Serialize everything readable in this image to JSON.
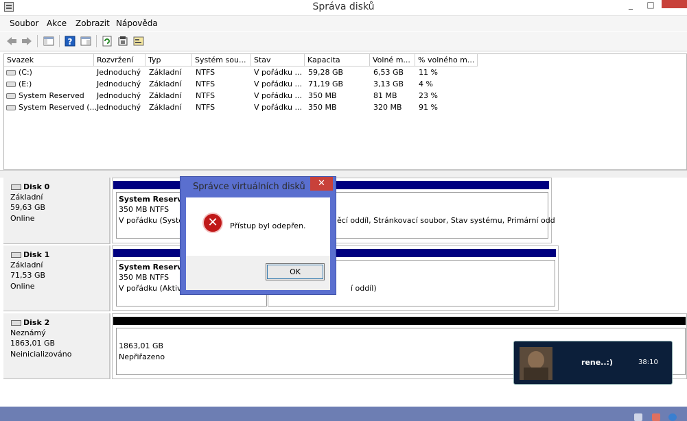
{
  "window": {
    "title": "Správa disků",
    "minimize": "_",
    "maximize": "□"
  },
  "menu": [
    "Soubor",
    "Akce",
    "Zobrazit",
    "Nápověda"
  ],
  "toolbar": [
    "back-icon",
    "forward-icon",
    "console-tree-icon",
    "help-icon",
    "properties-icon",
    "refresh-icon",
    "settings-icon",
    "export-icon"
  ],
  "volume_table": {
    "columns": [
      "Svazek",
      "Rozvržení",
      "Typ",
      "Systém sou...",
      "Stav",
      "Kapacita",
      "Volné m...",
      "% volného m..."
    ],
    "rows": [
      [
        "(C:)",
        "Jednoduchý",
        "Základní",
        "NTFS",
        "V pořádku ...",
        "59,28 GB",
        "6,53 GB",
        "11 %"
      ],
      [
        "(E:)",
        "Jednoduchý",
        "Základní",
        "NTFS",
        "V pořádku ...",
        "71,19 GB",
        "3,13 GB",
        "4 %"
      ],
      [
        "System Reserved",
        "Jednoduchý",
        "Základní",
        "NTFS",
        "V pořádku ...",
        "350 MB",
        "81 MB",
        "23 %"
      ],
      [
        "System Reserved (...",
        "Jednoduchý",
        "Základní",
        "NTFS",
        "V pořádku ...",
        "350 MB",
        "320 MB",
        "91 %"
      ]
    ]
  },
  "disks": [
    {
      "name": "Disk 0",
      "type": "Základní",
      "size": "59,63 GB",
      "status": "Online",
      "partitions": [
        {
          "name": "System Reserve",
          "size": "350 MB NTFS",
          "state": "V pořádku (Systé"
        },
        {
          "name": "",
          "size": "",
          "state": "ěcí oddíl, Stránkovací soubor, Stav systému, Primární odd"
        }
      ]
    },
    {
      "name": "Disk 1",
      "type": "Základní",
      "size": "71,53 GB",
      "status": "Online",
      "partitions": [
        {
          "name": "System Reserve",
          "size": "350 MB NTFS",
          "state": "V pořádku (Aktivr"
        },
        {
          "name": "",
          "size": "",
          "state": "í oddíl)"
        }
      ]
    },
    {
      "name": "Disk 2",
      "type": "Neznámý",
      "size": "1863,01 GB",
      "status": "Neinicializováno",
      "partitions": [
        {
          "name": "",
          "size": "1863,01 GB",
          "state": "Nepřiřazeno"
        }
      ]
    }
  ],
  "dialog": {
    "title": "Správce virtuálních disků",
    "close": "✕",
    "message": "Přístup byl odepřen.",
    "ok_label": "OK",
    "icon": "error-icon"
  },
  "notification": {
    "name": "rene..:)",
    "time": "38:10"
  },
  "colors": {
    "partition_bar": "#000080",
    "unallocated_bar": "#000000",
    "dialog_frame": "#5a6fcf",
    "close_button": "#c8413a",
    "taskbar": "#6d7eb3"
  }
}
